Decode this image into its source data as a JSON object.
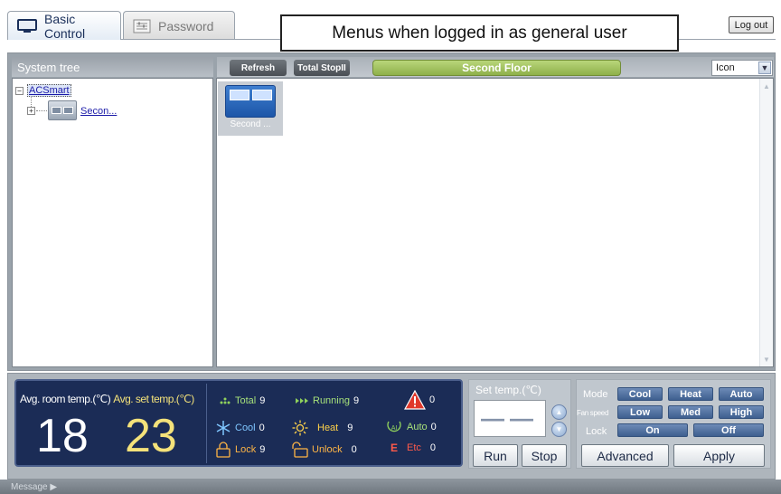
{
  "tabs": {
    "basic_control": "Basic Control",
    "password": "Password"
  },
  "note": "Menus when logged in as general user",
  "logout_label": "Log out",
  "tree": {
    "header": "System tree",
    "root_label": "ACSmart",
    "child_label": "Secon..."
  },
  "toolbar": {
    "refresh_label": "Refresh",
    "total_stop_label": "Total StopII",
    "floor_label": "Second Floor",
    "view_select_value": "Icon"
  },
  "unit_card": {
    "label": "Second ..."
  },
  "status": {
    "avg_room_label": "Avg. room temp.(℃)",
    "avg_set_label": "Avg. set temp.(℃)",
    "avg_room_value": "18",
    "avg_set_value": "23",
    "total_label": "Total",
    "total_count": "9",
    "running_label": "Running",
    "running_count": "9",
    "alarm_count": "0",
    "cool_label": "Cool",
    "cool_count": "0",
    "heat_label": "Heat",
    "heat_count": "9",
    "auto_label": "Auto",
    "auto_count": "0",
    "lock_label": "Lock",
    "lock_count": "9",
    "unlock_label": "Unlock",
    "unlock_count": "0",
    "etc_label": "Etc",
    "etc_count": "0"
  },
  "set_temp": {
    "label": "Set temp.(℃)",
    "value": "——",
    "run_label": "Run",
    "stop_label": "Stop"
  },
  "controls": {
    "mode_label": "Mode",
    "fan_speed_label": "Fan speed",
    "lock_label": "Lock",
    "mode_cool": "Cool",
    "mode_heat": "Heat",
    "mode_auto": "Auto",
    "fan_low": "Low",
    "fan_med": "Med",
    "fan_high": "High",
    "lock_on": "On",
    "lock_off": "Off",
    "advanced_label": "Advanced",
    "apply_label": "Apply"
  },
  "message_label": "Message ▶",
  "colors": {
    "status_panel_bg": "#1b2c56",
    "avg_set_color": "#f4e27a",
    "floor_label_bg": "#9cbf5a",
    "control_button_bg": "#4e6d9c",
    "alarm_red": "#e0382b"
  }
}
